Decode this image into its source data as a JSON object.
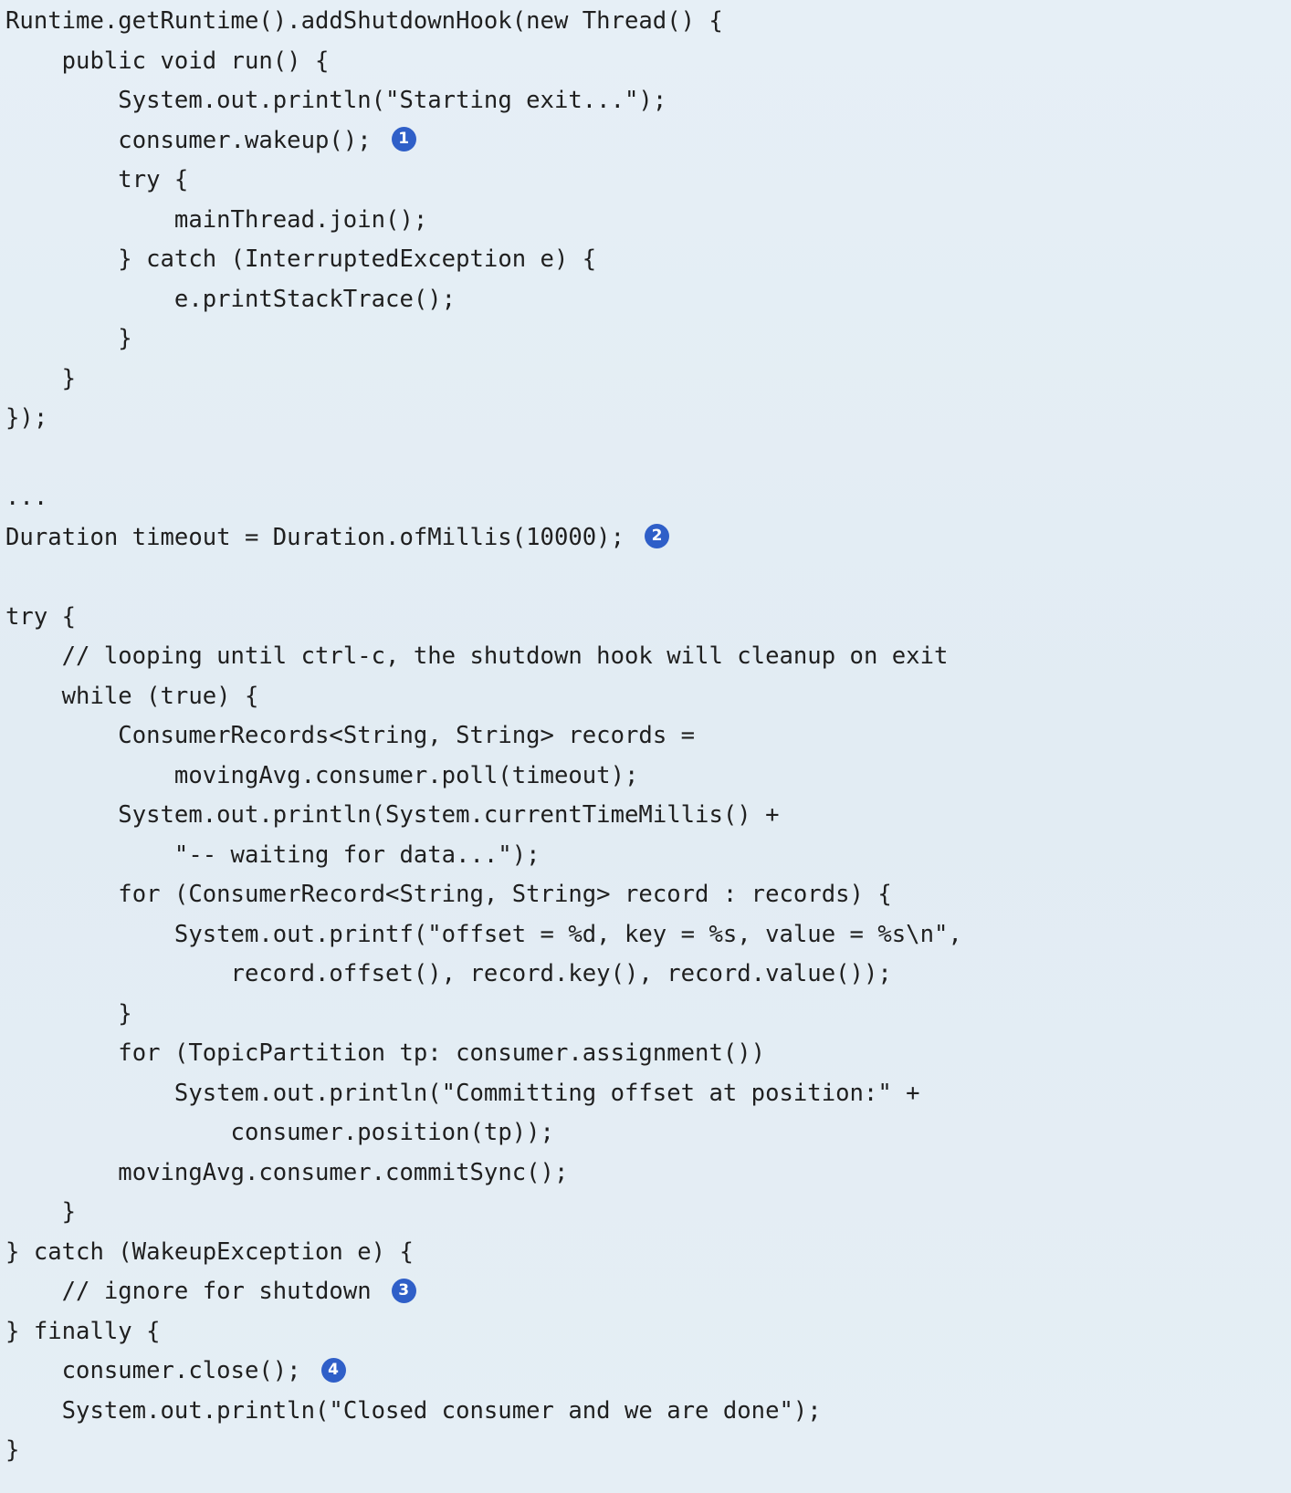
{
  "code": {
    "lines": [
      {
        "indent": 0,
        "text": "Runtime.getRuntime().addShutdownHook(new Thread() {",
        "callout": ""
      },
      {
        "indent": 1,
        "text": "public void run() {",
        "callout": ""
      },
      {
        "indent": 2,
        "text": "System.out.println(\"Starting exit...\");",
        "callout": ""
      },
      {
        "indent": 2,
        "text": "consumer.wakeup();",
        "callout": "1"
      },
      {
        "indent": 2,
        "text": "try {",
        "callout": ""
      },
      {
        "indent": 3,
        "text": "mainThread.join();",
        "callout": ""
      },
      {
        "indent": 2,
        "text": "} catch (InterruptedException e) {",
        "callout": ""
      },
      {
        "indent": 3,
        "text": "e.printStackTrace();",
        "callout": ""
      },
      {
        "indent": 2,
        "text": "}",
        "callout": ""
      },
      {
        "indent": 1,
        "text": "}",
        "callout": ""
      },
      {
        "indent": 0,
        "text": "});",
        "callout": ""
      },
      {
        "indent": 0,
        "text": "",
        "callout": ""
      },
      {
        "indent": 0,
        "text": "...",
        "callout": ""
      },
      {
        "indent": 0,
        "text": "Duration timeout = Duration.ofMillis(10000);",
        "callout": "2"
      },
      {
        "indent": 0,
        "text": "",
        "callout": ""
      },
      {
        "indent": 0,
        "text": "try {",
        "callout": ""
      },
      {
        "indent": 1,
        "text": "// looping until ctrl-c, the shutdown hook will cleanup on exit",
        "callout": ""
      },
      {
        "indent": 1,
        "text": "while (true) {",
        "callout": ""
      },
      {
        "indent": 2,
        "text": "ConsumerRecords<String, String> records =",
        "callout": ""
      },
      {
        "indent": 3,
        "text": "movingAvg.consumer.poll(timeout);",
        "callout": ""
      },
      {
        "indent": 2,
        "text": "System.out.println(System.currentTimeMillis() +",
        "callout": ""
      },
      {
        "indent": 3,
        "text": "\"-- waiting for data...\");",
        "callout": ""
      },
      {
        "indent": 2,
        "text": "for (ConsumerRecord<String, String> record : records) {",
        "callout": ""
      },
      {
        "indent": 3,
        "text": "System.out.printf(\"offset = %d, key = %s, value = %s\\n\",",
        "callout": ""
      },
      {
        "indent": 4,
        "text": "record.offset(), record.key(), record.value());",
        "callout": ""
      },
      {
        "indent": 2,
        "text": "}",
        "callout": ""
      },
      {
        "indent": 2,
        "text": "for (TopicPartition tp: consumer.assignment())",
        "callout": ""
      },
      {
        "indent": 3,
        "text": "System.out.println(\"Committing offset at position:\" +",
        "callout": ""
      },
      {
        "indent": 4,
        "text": "consumer.position(tp));",
        "callout": ""
      },
      {
        "indent": 2,
        "text": "movingAvg.consumer.commitSync();",
        "callout": ""
      },
      {
        "indent": 1,
        "text": "}",
        "callout": ""
      },
      {
        "indent": 0,
        "text": "} catch (WakeupException e) {",
        "callout": ""
      },
      {
        "indent": 1,
        "text": "// ignore for shutdown",
        "callout": "3"
      },
      {
        "indent": 0,
        "text": "} finally {",
        "callout": ""
      },
      {
        "indent": 1,
        "text": "consumer.close();",
        "callout": "4"
      },
      {
        "indent": 1,
        "text": "System.out.println(\"Closed consumer and we are done\");",
        "callout": ""
      },
      {
        "indent": 0,
        "text": "}",
        "callout": ""
      }
    ]
  }
}
